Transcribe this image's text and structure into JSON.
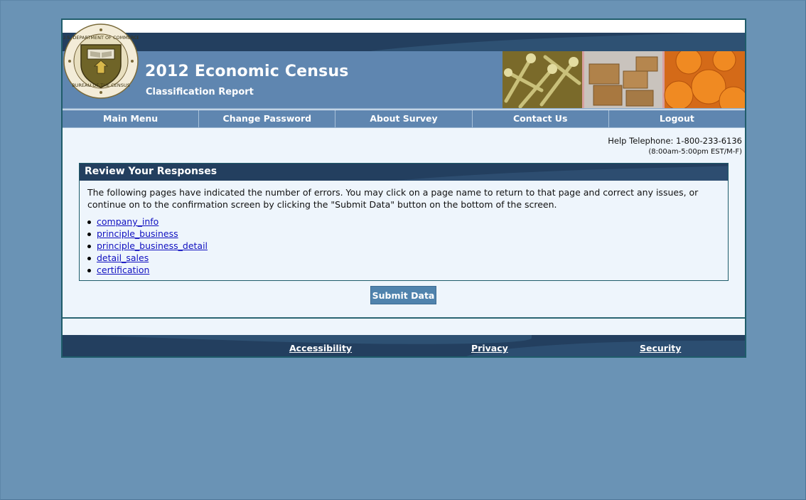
{
  "header": {
    "title": "2012 Economic Census",
    "subtitle": "Classification Report",
    "seal_text_top": "U.S. DEPARTMENT OF COMMERCE",
    "seal_text_bottom": "BUREAU OF THE CENSUS"
  },
  "nav": {
    "items": [
      {
        "label": "Main Menu"
      },
      {
        "label": "Change Password"
      },
      {
        "label": "About Survey"
      },
      {
        "label": "Contact Us"
      },
      {
        "label": "Logout"
      }
    ]
  },
  "help": {
    "telephone": "Help Telephone: 1-800-233-6136",
    "hours": "(8:00am-5:00pm EST/M-F)"
  },
  "review": {
    "title": "Review Your Responses",
    "instructions": "The following pages have indicated the number of errors. You may click on a page name to return to that page and correct any issues, or continue on to the confirmation screen by clicking the \"Submit Data\" button on the bottom of the screen.",
    "pages": [
      {
        "label": "company_info"
      },
      {
        "label": "principle_business"
      },
      {
        "label": "principle_business_detail"
      },
      {
        "label": "detail_sales"
      },
      {
        "label": "certification"
      }
    ]
  },
  "actions": {
    "submit_label": "Submit Data"
  },
  "footer": {
    "links": [
      {
        "label": "Accessibility"
      },
      {
        "label": "Privacy"
      },
      {
        "label": "Security"
      }
    ]
  },
  "colors": {
    "page_background": "#6a93b5",
    "header_dark": "#233f5f",
    "header_blue": "#5f86b0",
    "content_background": "#eef5fc",
    "link": "#1010c0",
    "button": "#5083ad"
  }
}
